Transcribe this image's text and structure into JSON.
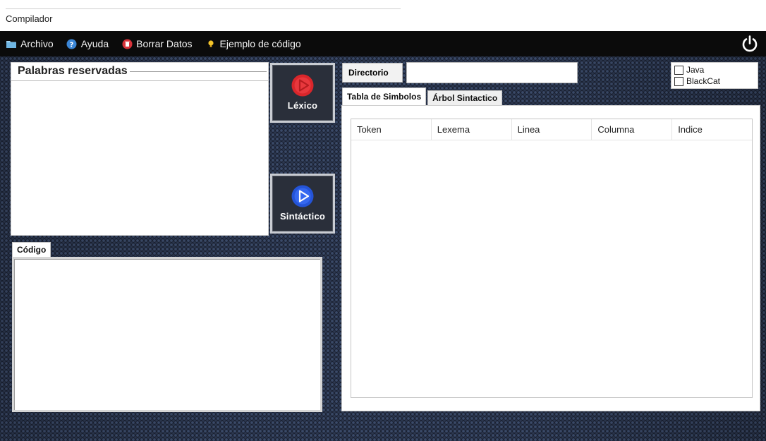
{
  "window": {
    "title": "Compilador"
  },
  "menu": {
    "archivo": {
      "label": "Archivo",
      "icon": "folder-icon"
    },
    "ayuda": {
      "label": "Ayuda",
      "icon": "help-icon"
    },
    "borrar": {
      "label": "Borrar Datos",
      "icon": "trash-icon"
    },
    "ejemplo": {
      "label": "Ejemplo de código",
      "icon": "lightbulb-icon"
    },
    "power_icon": "power-icon"
  },
  "reserved_panel": {
    "title": "Palabras reservadas"
  },
  "buttons": {
    "lexico": {
      "label": "Léxico",
      "color": "#d9262b"
    },
    "sintactico": {
      "label": "Sintáctico",
      "color": "#2454d8"
    }
  },
  "code_panel": {
    "tab_label": "Código",
    "value": ""
  },
  "directory": {
    "button_label": "Directorio",
    "value": ""
  },
  "languages": [
    {
      "label": "Java",
      "checked": false
    },
    {
      "label": "BlackCat",
      "checked": false
    }
  ],
  "tabs": [
    {
      "label": "Tabla de Simbolos",
      "active": true
    },
    {
      "label": "Árbol Sintactico",
      "active": false
    }
  ],
  "symbol_table": {
    "columns": [
      "Token",
      "Lexema",
      "Linea",
      "Columna",
      "Indice"
    ],
    "rows": []
  },
  "colors": {
    "menubar": "#0b0b0b",
    "background": "#1b2233"
  }
}
